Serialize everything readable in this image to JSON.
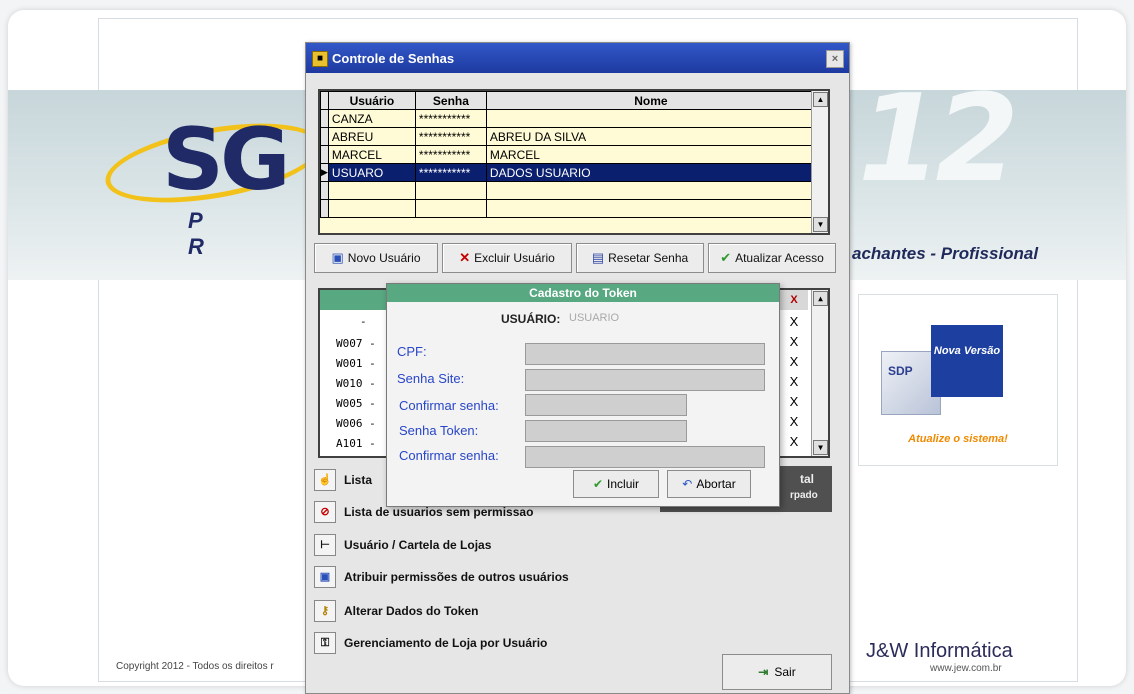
{
  "background": {
    "brand_partial": "12",
    "subtitle": "achantes - Profissional",
    "logo_letters": "SG",
    "logo_sub": "P R",
    "ad": {
      "badge": "Nova Versão",
      "box_label": "SDP",
      "update_text": "Atualize o sistema!"
    },
    "company": "J&W Informática",
    "url": "www.jew.com.br",
    "copyright": "Copyright 2012 - Todos os direitos r"
  },
  "window": {
    "title": "Controle de Senhas",
    "close_symbol": "×",
    "users_table": {
      "headers": [
        "Usuário",
        "Senha",
        "Nome"
      ],
      "rows": [
        {
          "usuario": "CANZA",
          "senha": "***********",
          "nome": ""
        },
        {
          "usuario": "ABREU",
          "senha": "***********",
          "nome": "ABREU DA SILVA"
        },
        {
          "usuario": "MARCEL",
          "senha": "***********",
          "nome": "MARCEL"
        },
        {
          "usuario": "USUARO",
          "senha": "***********",
          "nome": "DADOS USUARIO"
        }
      ]
    },
    "buttons": {
      "novo": "Novo Usuário",
      "excluir": "Excluir Usuário",
      "resetar": "Resetar Senha",
      "atualizar": "Atualizar Acesso"
    },
    "perm_rows": [
      "-",
      "W007 -",
      "W001 -",
      "W010 -",
      "W005 -",
      "W006 -",
      "A101 -"
    ],
    "perm_x": "X",
    "menu": {
      "lista": "Lista",
      "lista_sem": "Lista de usuarios sem permissao",
      "cartela": "Usuário / Cartela de Lojas",
      "atribuir": "Atribuir permissões de outros usuários",
      "alterar": "Alterar Dados do Token",
      "gerenciamento": "Gerenciamento de Loja por Usuário"
    },
    "total_partial": {
      "line1": "tal",
      "line2": "rpado"
    },
    "sair": "Sair"
  },
  "dialog": {
    "title": "Cadastro do Token",
    "usuario_label": "USUÁRIO:",
    "usuario_value": "USUARIO",
    "fields": {
      "cpf": "CPF:",
      "senha_site": "Senha Site:",
      "confirmar1": "Confirmar senha:",
      "senha_token": "Senha Token:",
      "confirmar2": "Confirmar senha:"
    },
    "incluir": "Incluir",
    "abortar": "Abortar"
  }
}
